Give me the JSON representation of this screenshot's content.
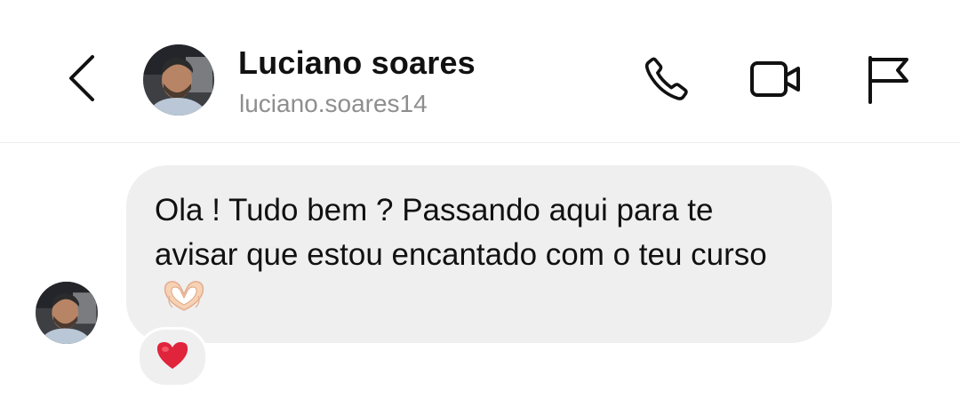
{
  "header": {
    "contact_name": "Luciano soares",
    "contact_handle": "luciano.soares14",
    "back_icon": "chevron-left-icon",
    "actions": [
      "phone-icon",
      "video-camera-icon",
      "flag-icon"
    ]
  },
  "conversation": {
    "messages": [
      {
        "sender": "Luciano soares",
        "text": "Ola ! Tudo bem ? Passando aqui para te avisar que estou encantado com o teu curso",
        "emoji": "heart-hands",
        "reaction": "red-heart"
      }
    ]
  },
  "colors": {
    "bubble_background": "#efeff0",
    "handle_text": "#8e8e8e",
    "reaction_heart": "#e0243b",
    "divider": "#ececec"
  }
}
